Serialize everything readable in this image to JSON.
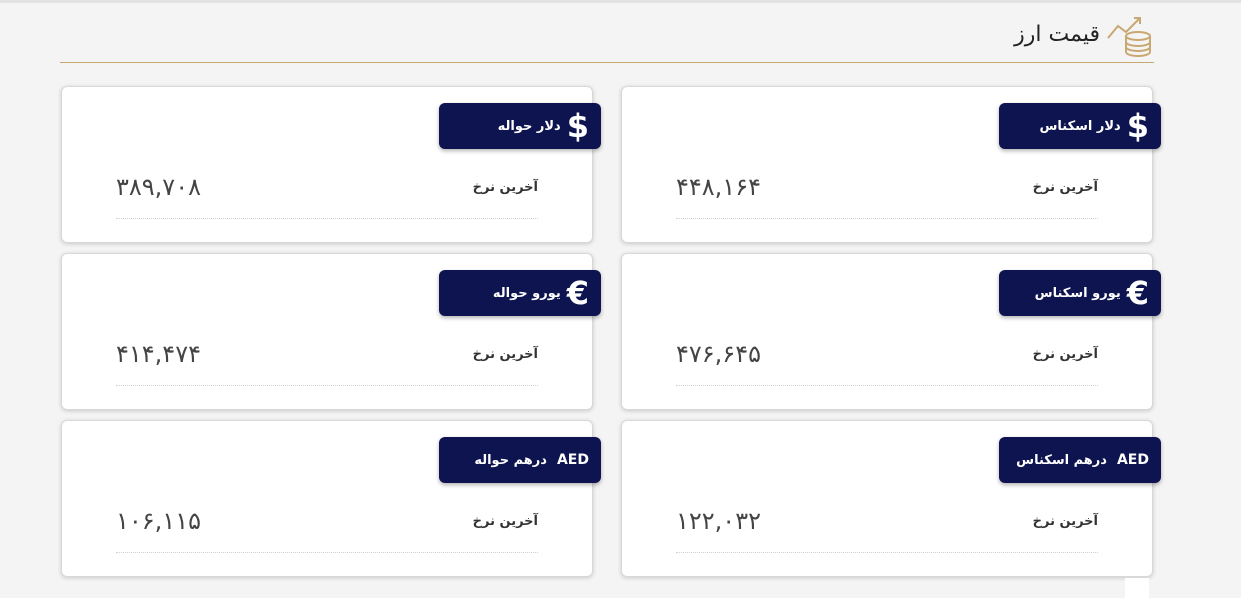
{
  "header": {
    "title": "قیمت ارز",
    "icon": "coins-chart-icon"
  },
  "colors": {
    "badge_bg": "#0d1450",
    "accent_line": "#c9a772",
    "card_bg": "#ffffff",
    "page_bg": "#f4f4f4"
  },
  "cards": [
    {
      "id": "usd-cash",
      "icon": "$",
      "icon_name": "dollar-icon",
      "label": "دلار اسکناس",
      "rate_label": "آخرین نرخ",
      "value": "۴۴۸,۱۶۴"
    },
    {
      "id": "usd-transfer",
      "icon": "$",
      "icon_name": "dollar-icon",
      "label": "دلار حواله",
      "rate_label": "آخرین نرخ",
      "value": "۳۸۹,۷۰۸"
    },
    {
      "id": "eur-cash",
      "icon": "€",
      "icon_name": "euro-icon",
      "label": "یورو اسکناس",
      "rate_label": "آخرین نرخ",
      "value": "۴۷۶,۶۴۵"
    },
    {
      "id": "eur-transfer",
      "icon": "€",
      "icon_name": "euro-icon",
      "label": "یورو حواله",
      "rate_label": "آخرین نرخ",
      "value": "۴۱۴,۴۷۴"
    },
    {
      "id": "aed-cash",
      "icon": "AED",
      "icon_name": "aed-icon",
      "label": "درهم اسکناس",
      "rate_label": "آخرین نرخ",
      "value": "۱۲۲,۰۳۲"
    },
    {
      "id": "aed-transfer",
      "icon": "AED",
      "icon_name": "aed-icon",
      "label": "درهم حواله",
      "rate_label": "آخرین نرخ",
      "value": "۱۰۶,۱۱۵"
    }
  ]
}
